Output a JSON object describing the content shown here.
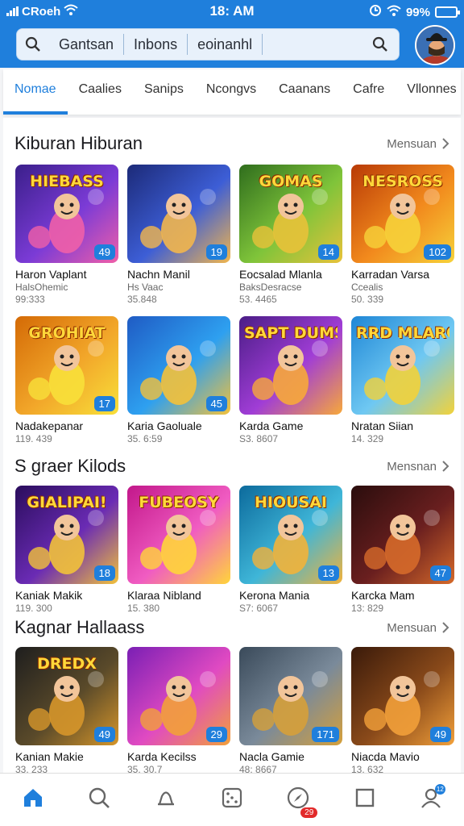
{
  "status": {
    "carrier": "CRoeh",
    "time": "18: AM",
    "battery": "99%"
  },
  "search": {
    "segments": [
      "Gantsan",
      "Inbons",
      "eoinanhl"
    ]
  },
  "tabs": [
    {
      "label": "Nomae",
      "active": true
    },
    {
      "label": "Caalies"
    },
    {
      "label": "Sanips"
    },
    {
      "label": "Ncongvs"
    },
    {
      "label": "Caanans"
    },
    {
      "label": "Cafre"
    },
    {
      "label": "Vllonnes"
    }
  ],
  "sections": [
    {
      "title": "Kiburan Hiburan",
      "more": "Mensuan",
      "rows": [
        [
          {
            "banner": "HIEBASS",
            "name": "Haron Vaplant",
            "sub": "HalsOhemic",
            "count": "99:333",
            "badge": "49",
            "colors": [
              "#3a1f8a",
              "#7b3bd6",
              "#f05fa8"
            ]
          },
          {
            "banner": "",
            "name": "Nachn Manil",
            "sub": "Hs Vaac",
            "count": "35.848",
            "badge": "19",
            "colors": [
              "#1c2a78",
              "#3d5ed6",
              "#f2b64c"
            ]
          },
          {
            "banner": "GOMAS",
            "name": "Eocsalad Mlanla",
            "sub": "BaksDesracse",
            "count": "53. 4465",
            "badge": "14",
            "colors": [
              "#2f6d1d",
              "#7fc43a",
              "#e8c23a"
            ]
          },
          {
            "banner": "NESROSS",
            "name": "Karradan Varsa",
            "sub": "Ccealis",
            "count": "50. 339",
            "badge": "102",
            "colors": [
              "#b83a06",
              "#f28a1d",
              "#f6d23a"
            ]
          }
        ],
        [
          {
            "banner": "GROHIAT",
            "name": "Nadakepanar",
            "sub": "",
            "count": "119. 439",
            "badge": "17",
            "colors": [
              "#d46a06",
              "#f2a72a",
              "#f8e03a"
            ]
          },
          {
            "banner": "",
            "name": "Karia Gaoluale",
            "sub": "",
            "count": "35. 6:59",
            "badge": "45",
            "colors": [
              "#1f5bc4",
              "#2ea0f0",
              "#f4c13a"
            ]
          },
          {
            "banner": "SAPT DUMSAES",
            "name": "Karda Game",
            "sub": "",
            "count": "S3. 8607",
            "badge": "",
            "colors": [
              "#4a1d86",
              "#a03dd6",
              "#f7a83a"
            ]
          },
          {
            "banner": "RRD MLAROS",
            "name": "Nratan Siian",
            "sub": "",
            "count": "14. 329",
            "badge": "",
            "colors": [
              "#1e86d6",
              "#6fc8f2",
              "#f2d23a"
            ]
          }
        ]
      ]
    },
    {
      "title": "S graer Kilods",
      "more": "Mensnan",
      "rows": [
        [
          {
            "banner": "GIALIPAI!",
            "name": "Kaniak Makik",
            "sub": "",
            "count": "119. 300",
            "badge": "18",
            "colors": [
              "#2a0d5c",
              "#6a2bb4",
              "#f2c23a"
            ]
          },
          {
            "banner": "FUBEOSY",
            "name": "Klaraa Nibland",
            "sub": "",
            "count": "15. 380",
            "badge": "",
            "colors": [
              "#c2178a",
              "#f05cc2",
              "#ffd53a"
            ]
          },
          {
            "banner": "HIOUSAI",
            "name": "Kerona Mania",
            "sub": "",
            "count": "S7: 6067",
            "badge": "13",
            "colors": [
              "#0c6a9c",
              "#3fb6d8",
              "#f2b23a"
            ]
          },
          {
            "banner": "",
            "name": "Karcka Mam",
            "sub": "",
            "count": "13: 829",
            "badge": "47",
            "colors": [
              "#2a0d0d",
              "#6a1f1f",
              "#d66a2a"
            ]
          }
        ]
      ]
    },
    {
      "title": "Kagnar Hallaass",
      "more": "Mensuan",
      "rows": [
        [
          {
            "banner": "DREDX",
            "name": "Kanian Makie",
            "sub": "",
            "count": "33. 233",
            "badge": "49",
            "colors": [
              "#1e1e1e",
              "#5a4a2a",
              "#d6962a"
            ]
          },
          {
            "banner": "",
            "name": "Karda Kecilss",
            "sub": "",
            "count": "35. 30.7",
            "badge": "29",
            "colors": [
              "#7a1fb4",
              "#e04ac2",
              "#f2a03a"
            ]
          },
          {
            "banner": "",
            "name": "Nacla Gamie",
            "sub": "",
            "count": "48: 8667",
            "badge": "171",
            "colors": [
              "#3a4a5a",
              "#7a8a9a",
              "#d6a03a"
            ]
          },
          {
            "banner": "",
            "name": "Niacda Mavio",
            "sub": "",
            "count": "13. 632",
            "badge": "49",
            "colors": [
              "#3a1a0a",
              "#8a4a1a",
              "#f2a03a"
            ]
          }
        ]
      ]
    }
  ],
  "bottom_nav": [
    {
      "icon": "home-icon",
      "active": true
    },
    {
      "icon": "search-icon"
    },
    {
      "icon": "bell-icon"
    },
    {
      "icon": "dice-icon"
    },
    {
      "icon": "compass-icon",
      "badge": "29"
    },
    {
      "icon": "square-icon"
    },
    {
      "icon": "profile-icon",
      "dot": "12"
    }
  ],
  "colors": {
    "accent": "#1f7fdc",
    "badge_red": "#e22a2a"
  }
}
